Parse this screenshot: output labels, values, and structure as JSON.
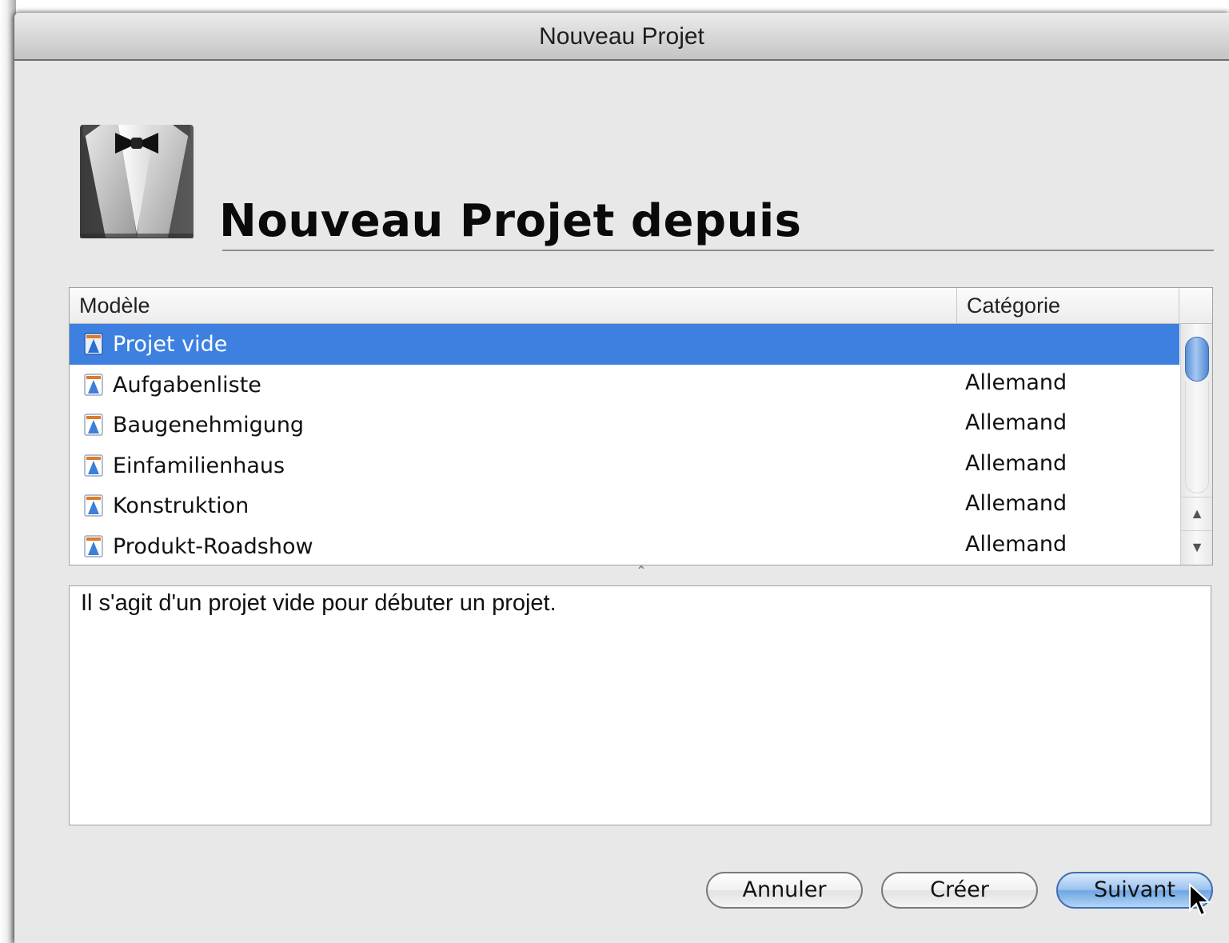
{
  "window": {
    "title": "Nouveau Projet"
  },
  "header": {
    "heading": "Nouveau Projet depuis",
    "icon": "tuxedo-icon"
  },
  "table": {
    "columns": {
      "model": "Modèle",
      "category": "Catégorie"
    },
    "rows": [
      {
        "name": "Projet vide",
        "category": "",
        "selected": true
      },
      {
        "name": "Aufgabenliste",
        "category": "Allemand",
        "selected": false
      },
      {
        "name": "Baugenehmigung",
        "category": "Allemand",
        "selected": false
      },
      {
        "name": "Einfamilienhaus",
        "category": "Allemand",
        "selected": false
      },
      {
        "name": "Konstruktion",
        "category": "Allemand",
        "selected": false
      },
      {
        "name": "Produkt-Roadshow",
        "category": "Allemand",
        "selected": false
      }
    ],
    "row_icon": "project-document-icon"
  },
  "description": {
    "text": "Il s'agit d'un projet vide pour débuter un projet."
  },
  "buttons": {
    "cancel": "Annuler",
    "create": "Créer",
    "next": "Suivant"
  },
  "colors": {
    "selection": "#3d80df",
    "default_button": "#9cc3ee"
  }
}
